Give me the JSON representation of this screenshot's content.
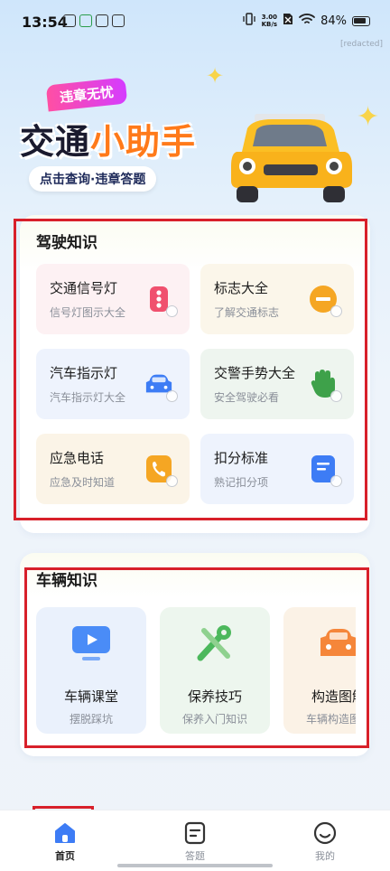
{
  "status_bar": {
    "time": "13:54",
    "net_speed_value": "3.00",
    "net_speed_unit": "KB/s",
    "battery": "84%"
  },
  "page_label": "[redacted]",
  "banner": {
    "tag": "违章无忧",
    "title_main": "交通",
    "title_accent": "小助手",
    "subtitle": "点击查询·违章答题"
  },
  "driving": {
    "title": "驾驶知识",
    "tiles": [
      {
        "title": "交通信号灯",
        "sub": "信号灯图示大全",
        "icon": "traffic-light-icon",
        "color": "#f0506e",
        "bg": "#fdf1f3"
      },
      {
        "title": "标志大全",
        "sub": "了解交通标志",
        "icon": "sign-icon",
        "color": "#f5a623",
        "bg": "#fbf6ea"
      },
      {
        "title": "汽车指示灯",
        "sub": "汽车指示灯大全",
        "icon": "car-light-icon",
        "color": "#3d7cf5",
        "bg": "#eef3fd"
      },
      {
        "title": "交警手势大全",
        "sub": "安全驾驶必看",
        "icon": "hand-gesture-icon",
        "color": "#3ea14a",
        "bg": "#eef5ef"
      },
      {
        "title": "应急电话",
        "sub": "应急及时知道",
        "icon": "phone-icon",
        "color": "#f5a623",
        "bg": "#fbf4e7"
      },
      {
        "title": "扣分标准",
        "sub": "熟记扣分项",
        "icon": "document-icon",
        "color": "#3d7cf5",
        "bg": "#eef3fd"
      }
    ]
  },
  "vehicle": {
    "title": "车辆知识",
    "tiles": [
      {
        "title": "车辆课堂",
        "sub": "摆脱踩坑",
        "icon": "video-class-icon",
        "color": "#4a8cf7",
        "bg": "#eaf1fc"
      },
      {
        "title": "保养技巧",
        "sub": "保养入门知识",
        "icon": "tools-icon",
        "color": "#4cb85c",
        "bg": "#edf6ee"
      },
      {
        "title": "构造图解",
        "sub": "车辆构造图解",
        "icon": "car-structure-icon",
        "color": "#f5863a",
        "bg": "#fbf2e6"
      }
    ]
  },
  "nav": {
    "items": [
      {
        "label": "首页",
        "icon": "home-icon",
        "active": true
      },
      {
        "label": "答题",
        "icon": "quiz-icon",
        "active": false
      },
      {
        "label": "我的",
        "icon": "profile-icon",
        "active": false
      }
    ]
  }
}
